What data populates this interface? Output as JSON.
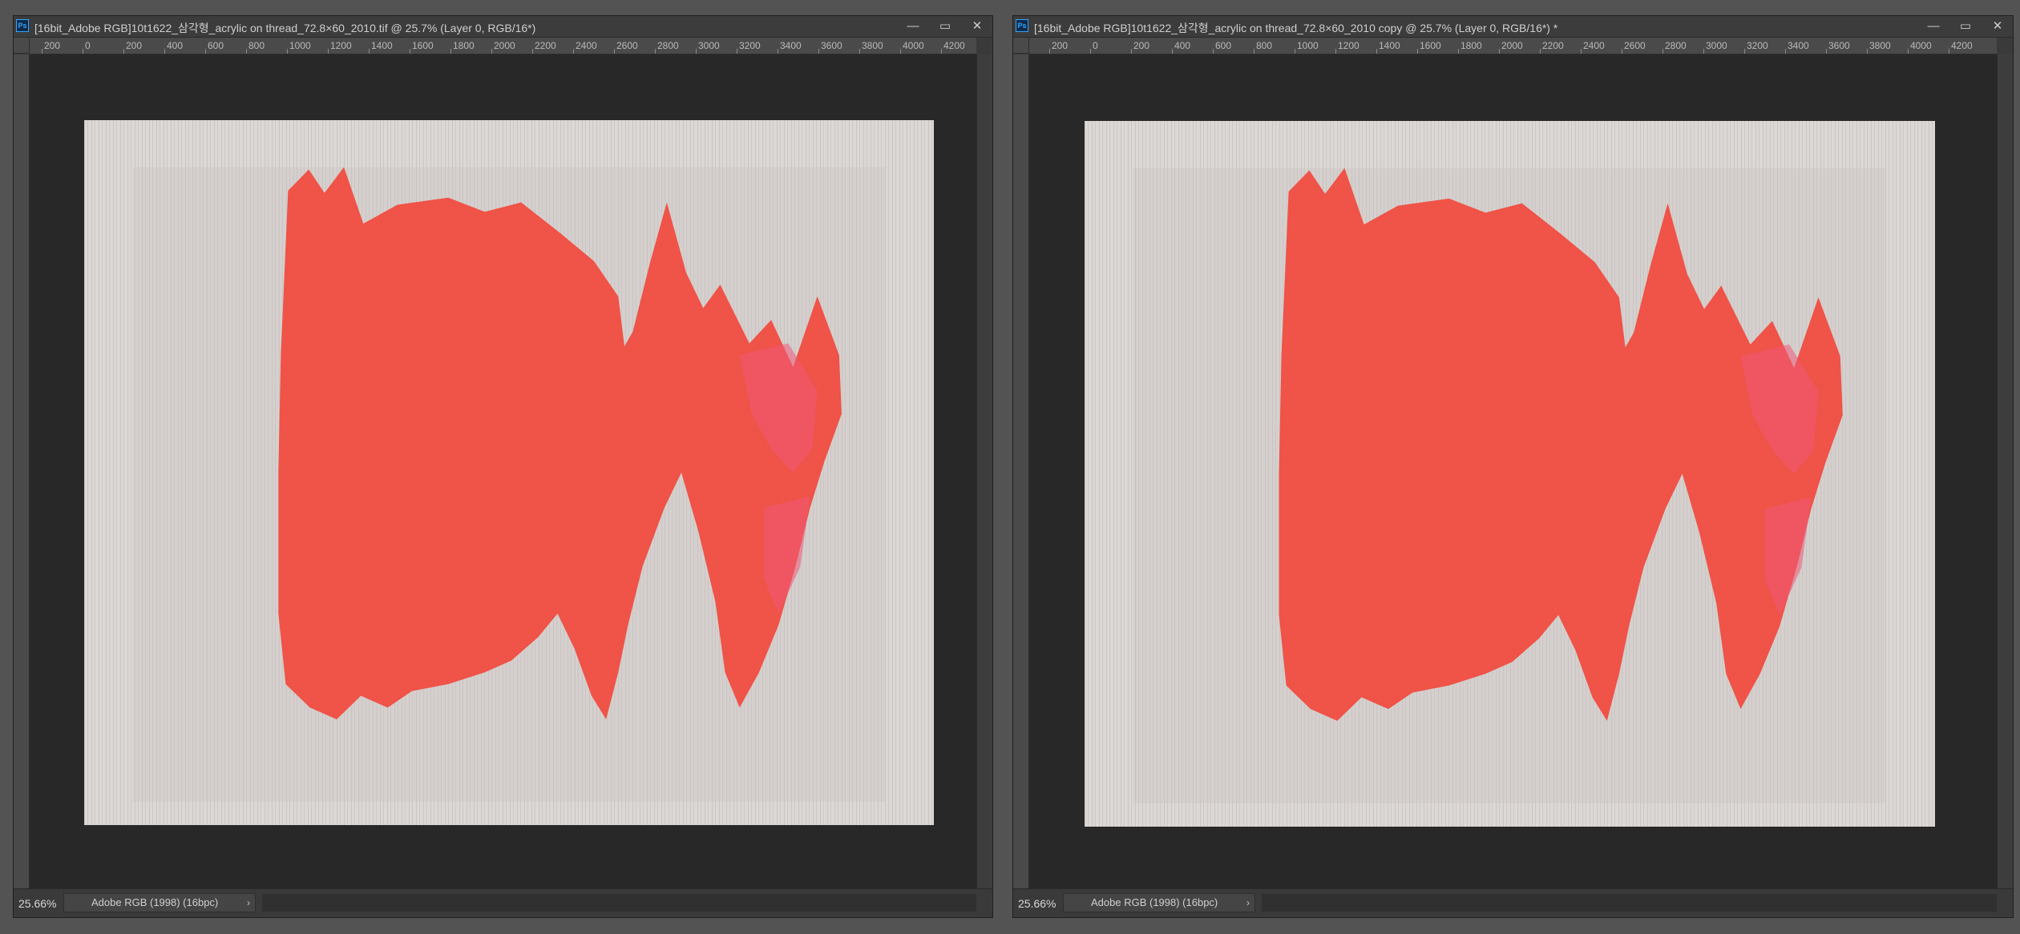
{
  "app": "Adobe Photoshop",
  "windows": [
    {
      "title": "[16bit_Adobe RGB]10t1622_삼각형_acrylic on thread_72.8×60_2010.tif @ 25.7% (Layer 0, RGB/16*)",
      "app_icon": "Ps",
      "ruler_labels": [
        "200",
        "0",
        "200",
        "400",
        "600",
        "800",
        "1000",
        "1200",
        "1400",
        "1600",
        "1800",
        "2000",
        "2200",
        "2400",
        "2600",
        "2800",
        "3000",
        "3200",
        "3400",
        "3600",
        "3800",
        "4000",
        "4200"
      ],
      "zoom": "25.66%",
      "doc_info": "Adobe RGB (1998) (16bpc)",
      "doc_info_arrow": "›"
    },
    {
      "title": "[16bit_Adobe RGB]10t1622_삼각형_acrylic on thread_72.8×60_2010 copy @ 25.7% (Layer 0, RGB/16*) *",
      "app_icon": "Ps",
      "ruler_labels": [
        "200",
        "0",
        "200",
        "400",
        "600",
        "800",
        "1000",
        "1200",
        "1400",
        "1600",
        "1800",
        "2000",
        "2200",
        "2400",
        "2600",
        "2800",
        "3000",
        "3200",
        "3400",
        "3600",
        "3800",
        "4000",
        "4200"
      ],
      "zoom": "25.66%",
      "doc_info": "Adobe RGB (1998) (16bpc)",
      "doc_info_arrow": "›"
    }
  ],
  "window_controls": {
    "minimize": "—",
    "maximize": "▭",
    "close": "✕"
  },
  "icons": [
    "photoshop-app-icon",
    "minimize-icon",
    "maximize-icon",
    "close-icon",
    "chevron-right-icon"
  ],
  "colors": {
    "canvas_bg": "#282828",
    "paint_red": "#f2483c",
    "paint_pink": "#ee5a78",
    "thread_bg": "#dcd8d6"
  }
}
